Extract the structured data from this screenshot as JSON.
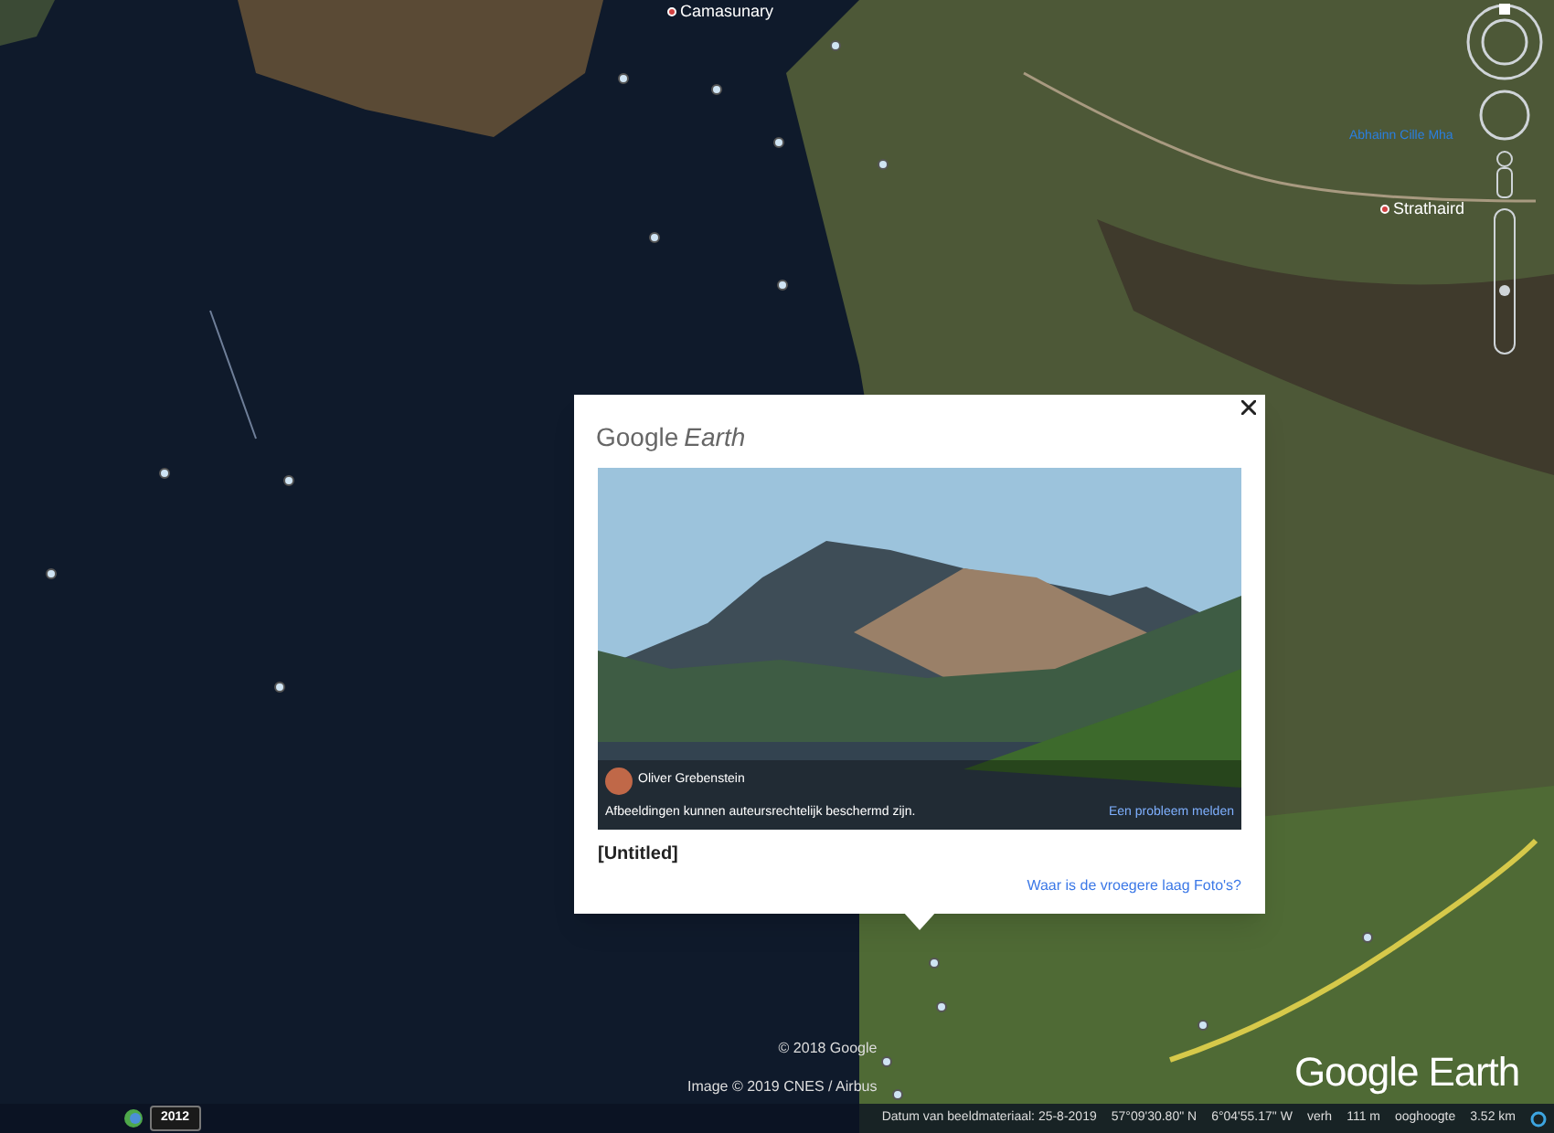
{
  "map": {
    "labels": [
      {
        "text": "Camasunary",
        "kind": "place"
      },
      {
        "text": "Strathaird",
        "kind": "place"
      },
      {
        "text": "Abhainn Cille Mha",
        "kind": "water"
      }
    ]
  },
  "popup": {
    "brand": "Google",
    "brand_italic": "Earth",
    "photographer": "Oliver Grebenstein",
    "copyright_note": "Afbeeldingen kunnen auteursrechtelijk beschermd zijn.",
    "report_link": "Een probleem melden",
    "title": "[Untitled]",
    "layer_link": "Waar is de vroegere laag Foto's?"
  },
  "attribution": [
    "© 2018 Google",
    "Image © 2019 CNES / Airbus"
  ],
  "logo": "Google Earth",
  "zoom_slider": {
    "level": 0.45
  },
  "historical_year": "2012",
  "status_bar": {
    "imagery_date": "Datum van beeldmateriaal: 25-8-2019",
    "latitude": "57°09'30.80\" N",
    "longitude": "6°04'55.17\" W",
    "elevation_label": "verh",
    "elevation": "111 m",
    "eye_label": "ooghoogte",
    "eye_altitude": "3.52 km"
  }
}
